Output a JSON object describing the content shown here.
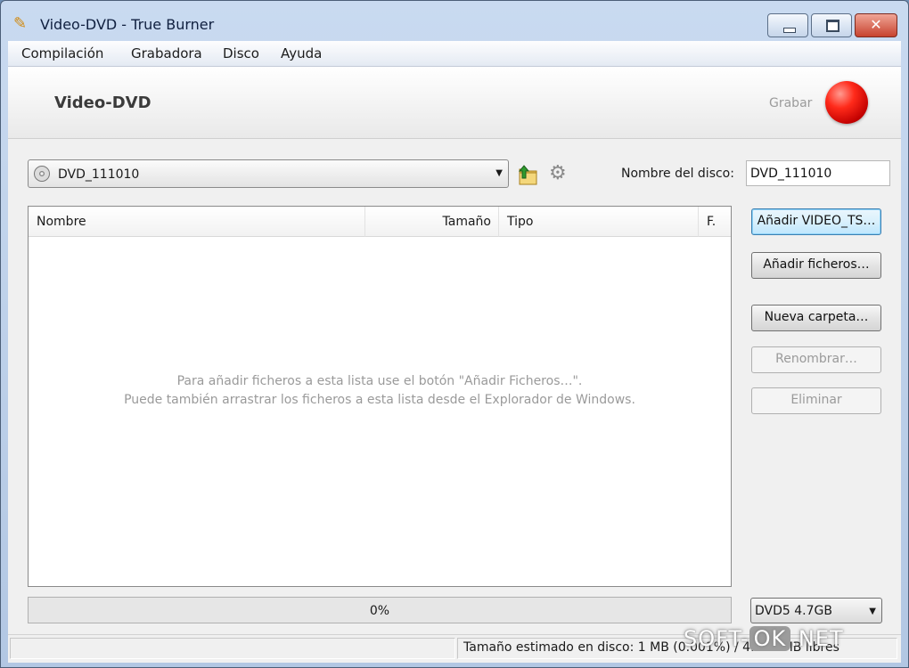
{
  "window": {
    "title": "Video-DVD - True Burner"
  },
  "menu": {
    "items": [
      "Compilación",
      "Grabadora",
      "Disco",
      "Ayuda"
    ]
  },
  "banner": {
    "title": "Video-DVD",
    "burn_label": "Grabar"
  },
  "disc": {
    "selected": "DVD_111010",
    "name_label": "Nombre del disco:",
    "name_value": "DVD_111010"
  },
  "list": {
    "columns": [
      "Nombre",
      "Tamaño",
      "Tipo",
      "F."
    ],
    "empty_line1": "Para añadir ficheros a esta lista use el botón \"Añadir Ficheros…\".",
    "empty_line2": "Puede también arrastrar los ficheros a esta lista desde el Explorador de Windows."
  },
  "buttons": {
    "add_video_ts": "Añadir VIDEO_TS…",
    "add_files": "Añadir ficheros…",
    "new_folder": "Nueva carpeta…",
    "rename": "Renombrar…",
    "delete": "Eliminar"
  },
  "progress": {
    "text": "0%",
    "value": 0
  },
  "capacity": {
    "selected": "DVD5 4.7GB"
  },
  "status": {
    "text": "Tamaño estimado en disco: 1 MB (0.001%) / 4.482 MB libres"
  },
  "watermark": {
    "prefix": "SOFT-",
    "ok": "OK",
    "suffix": ".NET"
  },
  "icons": {
    "app": "pen-icon",
    "disc": "cd-icon",
    "folder_up": "folder-up-icon",
    "settings": "gear-icon",
    "burn": "record-icon"
  },
  "colors": {
    "burn_button": "#e10000",
    "default_button_border": "#3c7fb1",
    "progress_fill": "#37b34a"
  }
}
